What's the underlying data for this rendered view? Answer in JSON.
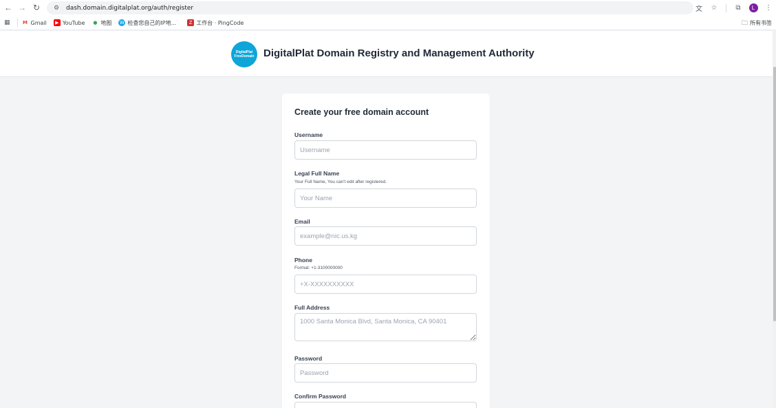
{
  "browser": {
    "url": "dash.domain.digitalplat.org/auth/register",
    "avatar_letter": "L",
    "bookmarks": [
      {
        "label": "Gmail",
        "icon": "gmail-icon"
      },
      {
        "label": "YouTube",
        "icon": "youtube-icon"
      },
      {
        "label": "地图",
        "icon": "maps-icon"
      },
      {
        "label": "检查您自己的IP地...",
        "icon": "ip-icon"
      },
      {
        "label": "工作台 · PingCode",
        "icon": "pingcode-icon"
      }
    ],
    "all_bookmarks": "所有书签"
  },
  "header": {
    "logo_line1": "DigitalPlat",
    "logo_line2": "FreeDomain",
    "title": "DigitalPlat Domain Registry and Management Authority"
  },
  "form": {
    "title": "Create your free domain account",
    "username": {
      "label": "Username",
      "placeholder": "Username"
    },
    "fullname": {
      "label": "Legal Full Name",
      "hint": "Your Full Name, You can't edit after registered.",
      "placeholder": "Your Name"
    },
    "email": {
      "label": "Email",
      "placeholder": "example@nic.us.kg"
    },
    "phone": {
      "label": "Phone",
      "hint": "Format: +1-3100000000",
      "placeholder": "+X-XXXXXXXXXX"
    },
    "address": {
      "label": "Full Address",
      "placeholder": "1000 Santa Monica Blvd, Santa Monica, CA 90401"
    },
    "password": {
      "label": "Password",
      "placeholder": "Password"
    },
    "confirm_password": {
      "label": "Confirm Password"
    }
  },
  "colors": {
    "brand": "#0ea5d9",
    "background": "#f3f4f6"
  }
}
